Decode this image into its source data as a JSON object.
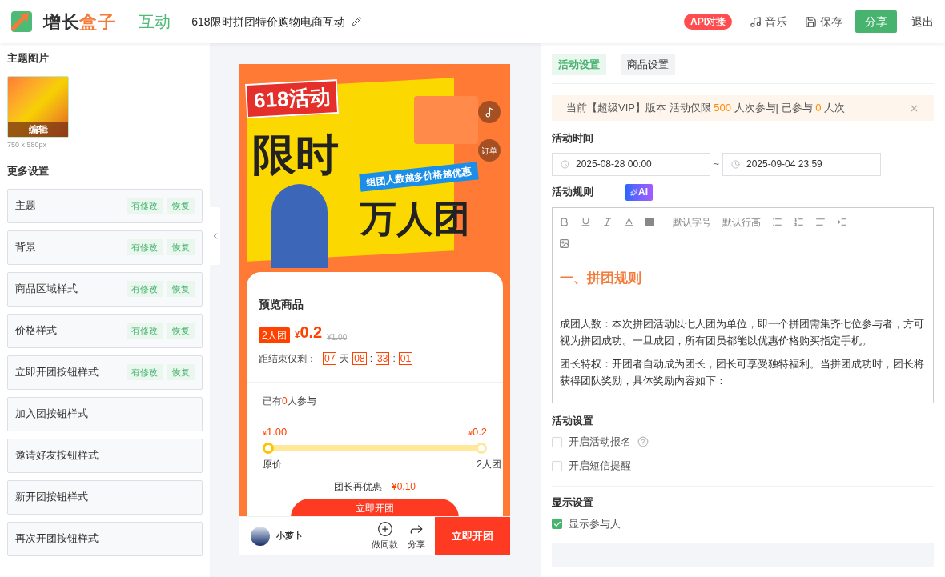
{
  "header": {
    "brand_a": "增长",
    "brand_b": "盒子",
    "module": "互动",
    "title": "618限时拼团特价购物电商互动",
    "api_badge": "API对接",
    "actions": [
      {
        "label": "音乐",
        "kind": "music"
      },
      {
        "label": "保存",
        "kind": "save"
      }
    ],
    "share": "分享",
    "exit": "退出"
  },
  "left": {
    "theme_title": "主题图片",
    "thumb_overlay": "编辑",
    "thumb_size": "750 x 580px",
    "more_title": "更多设置",
    "items": [
      {
        "label": "主题",
        "modified_tag": "有修改",
        "restore_tag": "恢复"
      },
      {
        "label": "背景",
        "modified_tag": "有修改",
        "restore_tag": "恢复"
      },
      {
        "label": "商品区域样式",
        "modified_tag": "有修改",
        "restore_tag": "恢复"
      },
      {
        "label": "价格样式",
        "modified_tag": "有修改",
        "restore_tag": "恢复"
      },
      {
        "label": "立即开团按钮样式",
        "modified_tag": "有修改",
        "restore_tag": "恢复"
      },
      {
        "label": "加入团按钮样式"
      },
      {
        "label": "邀请好友按钮样式"
      },
      {
        "label": "新开团按钮样式"
      },
      {
        "label": "再次开团按钮样式"
      }
    ]
  },
  "phone": {
    "banner": {
      "badge": "618活动",
      "line1": "限时",
      "line2": "万人团",
      "ribbon": "组团人数越多价格越优惠",
      "side_order": "订单"
    },
    "product": {
      "title": "预览商品",
      "group_badge": "2人团",
      "currency": "¥",
      "price": "0.2",
      "original": "¥1.00",
      "countdown_label": "距结束仅剩：",
      "countdown": [
        {
          "value": "07",
          "sep": "天"
        },
        {
          "value": "08",
          "sep": ":"
        },
        {
          "value": "33",
          "sep": ":"
        },
        {
          "value": "01"
        }
      ]
    },
    "joined": {
      "prefix": "已有",
      "count": "0",
      "suffix": "人参与"
    },
    "progress": {
      "currency": "¥",
      "left_price": "1.00",
      "right_price": "0.2",
      "start_label": "原价",
      "end_label": "2人团"
    },
    "leader": {
      "label": "团长再优惠",
      "value": "¥0.10"
    },
    "cta": "立即开团",
    "bottom": {
      "shop": "小萝卜",
      "actions": [
        {
          "label": "做同款",
          "kind": "plus"
        },
        {
          "label": "分享",
          "kind": "share"
        }
      ],
      "buy": "立即开团"
    }
  },
  "right": {
    "tabs": [
      {
        "label": "活动设置",
        "selected": true
      },
      {
        "label": "商品设置",
        "selected": false
      }
    ],
    "notice": {
      "prefix": "当前【超级VIP】版本 活动仅限",
      "limit": "500",
      "middle": "人次参与| 已参与",
      "joined": "0",
      "suffix": "人次"
    },
    "time": {
      "label": "活动时间",
      "start": "2025-08-28 00:00",
      "sep": "~",
      "end": "2025-09-04 23:59"
    },
    "rules": {
      "label": "活动规则",
      "ai": "AI",
      "font_size": "默认字号",
      "line_height": "默认行高",
      "heading": "一、拼团规则",
      "paragraphs": [
        "成团人数：本次拼团活动以七人团为单位，即一个拼团需集齐七位参与者，方可视为拼团成功。一旦成团，所有团员都能以优惠价格购买指定手机。",
        "团长特权：开团者自动成为团长，团长可享受独特福利。当拼团成功时，团长将获得团队奖励，具体奖励内容如下："
      ]
    },
    "activity": {
      "title": "活动设置",
      "options": [
        {
          "label": "开启活动报名",
          "checked": false,
          "help": true
        },
        {
          "label": "开启短信提醒",
          "checked": false,
          "help": false
        }
      ]
    },
    "display": {
      "title": "显示设置",
      "options": [
        {
          "label": "显示参与人",
          "checked": true,
          "help": false
        }
      ]
    }
  }
}
